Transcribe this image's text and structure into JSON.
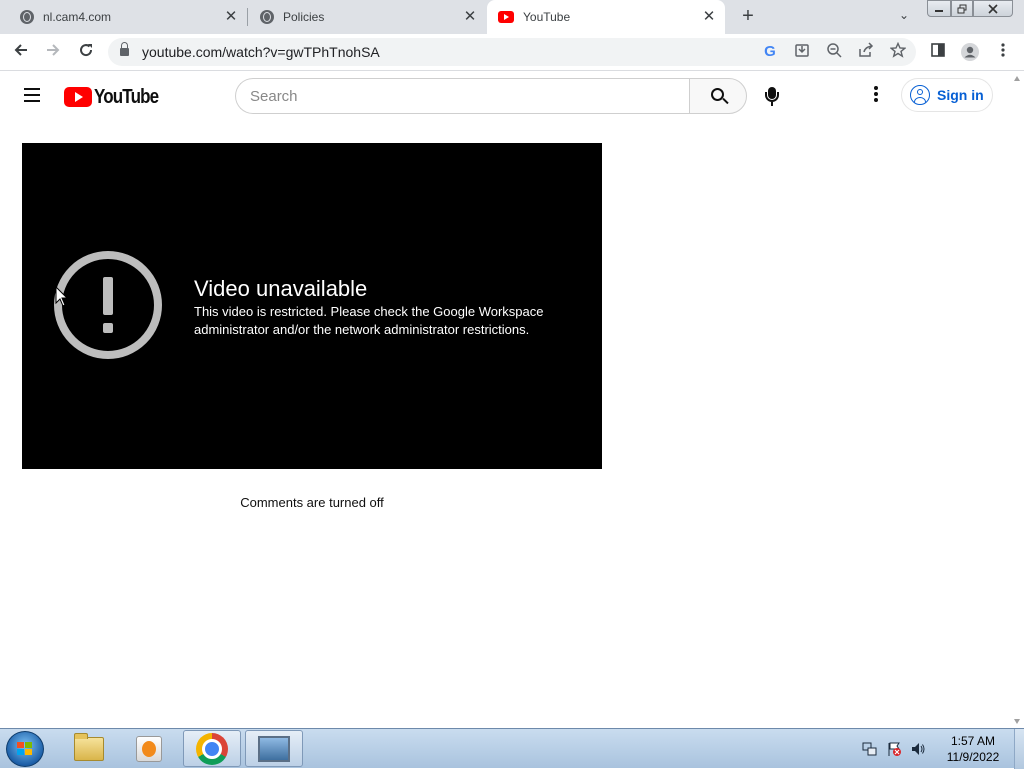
{
  "browser": {
    "tabs": [
      {
        "title": "nl.cam4.com",
        "icon": "globe-icon",
        "active": false
      },
      {
        "title": "Policies",
        "icon": "globe-icon",
        "active": false
      },
      {
        "title": "YouTube",
        "icon": "youtube-icon",
        "active": true
      }
    ],
    "tab_close_glyph": "✕",
    "new_tab_glyph": "+",
    "tab_search_glyph": "⌄",
    "url": "youtube.com/watch?v=gwTPhTnohSA"
  },
  "youtube": {
    "logo_text": "YouTube",
    "search_placeholder": "Search",
    "sign_in_label": "Sign in"
  },
  "player": {
    "error_title": "Video unavailable",
    "error_message": "This video is restricted. Please check the Google Workspace administrator and/or the network administrator restrictions."
  },
  "comments_status": "Comments are turned off",
  "taskbar": {
    "time": "1:57 AM",
    "date": "11/9/2022",
    "apps": [
      "windows-explorer",
      "media-player",
      "google-chrome",
      "image-viewer"
    ]
  },
  "colors": {
    "youtube_red": "#ff0000",
    "signin_blue": "#065fd4",
    "player_bg": "#000000",
    "tabstrip_bg": "#dee1e6"
  }
}
